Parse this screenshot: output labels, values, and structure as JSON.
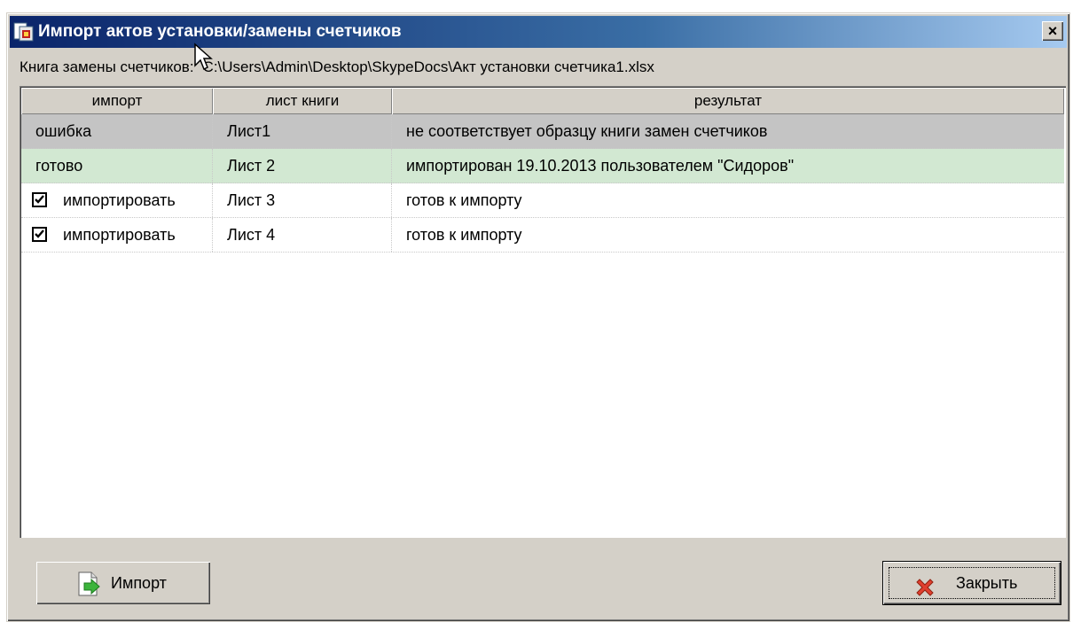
{
  "window": {
    "title": "Импорт актов установки/замены счетчиков",
    "close_glyph": "×"
  },
  "book": {
    "label": "Книга замены счетчиков:",
    "path": "C:\\Users\\Admin\\Desktop\\SkypeDocs\\Акт установки счетчика1.xlsx"
  },
  "table": {
    "columns": [
      "импорт",
      "лист книги",
      "результат"
    ],
    "rows": [
      {
        "import": "ошибка",
        "sheet": "Лист1",
        "result": "не соответствует образцу книги замен счетчиков",
        "status": "error",
        "checkbox": false
      },
      {
        "import": "готово",
        "sheet": "Лист 2",
        "result": "импортирован 19.10.2013 пользователем \"Сидоров\"",
        "status": "done",
        "checkbox": false
      },
      {
        "import": "импортировать",
        "sheet": "Лист 3",
        "result": "готов к импорту",
        "status": "ready",
        "checkbox": true
      },
      {
        "import": "импортировать",
        "sheet": "Лист 4",
        "result": "готов к импорту",
        "status": "ready",
        "checkbox": true
      }
    ]
  },
  "buttons": {
    "import_label": "Импорт",
    "close_label": "Закрыть"
  },
  "colors": {
    "titlebar_start": "#0a246a",
    "titlebar_end": "#a6caf0",
    "error_row": "#c4c4c4",
    "done_row": "#d2e8d2",
    "window_face": "#d4d0c8"
  },
  "icons": {
    "title": "excel-sheet-icon",
    "import": "document-green-arrow-icon",
    "close": "red-x-icon"
  }
}
